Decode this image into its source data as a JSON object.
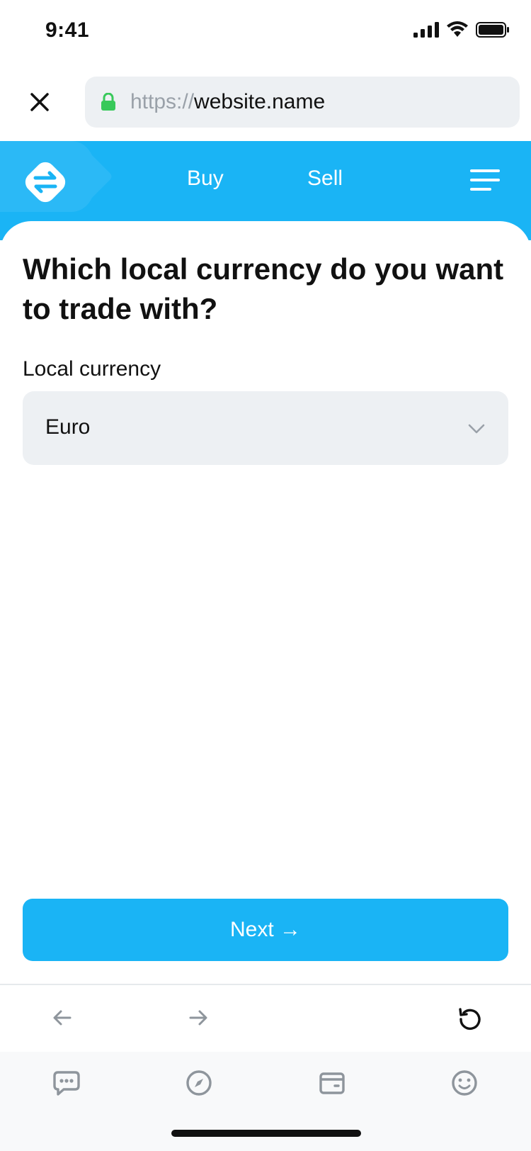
{
  "status_bar": {
    "time": "9:41",
    "icons": [
      "signal-icon",
      "wifi-icon",
      "battery-icon"
    ]
  },
  "browser": {
    "url_prefix": "https://",
    "url_host": "website.name",
    "secure": true
  },
  "header": {
    "nav": [
      {
        "label": "Buy"
      },
      {
        "label": "Sell"
      }
    ],
    "colors": {
      "brand": "#1ab4f5"
    }
  },
  "main": {
    "title": "Which local currency do you want to trade with?",
    "field_label": "Local currency",
    "selected_currency": "Euro",
    "next_label": "Next →"
  },
  "toolbar": {
    "icons": [
      "back-arrow-icon",
      "forward-arrow-icon",
      "reload-icon"
    ]
  },
  "tabs": [
    "chat-icon",
    "compass-icon",
    "wallet-icon",
    "smiley-icon"
  ]
}
